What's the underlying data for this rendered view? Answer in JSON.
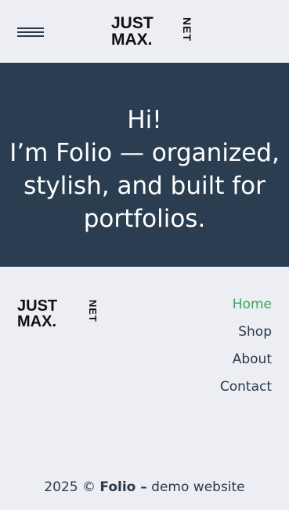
{
  "header": {
    "menu_icon": "hamburger-menu-icon",
    "logo": {
      "line1": "JUST",
      "line2": "MAX.",
      "vertical": "NET"
    }
  },
  "hero": {
    "greeting": "Hi!",
    "text": "I’m Folio — organized, stylish, and built for portfolios."
  },
  "footer": {
    "logo": {
      "line1": "JUST",
      "line2": "MAX.",
      "vertical": "NET"
    },
    "nav": [
      {
        "label": "Home",
        "active": true
      },
      {
        "label": "Shop"
      },
      {
        "label": "About"
      },
      {
        "label": "Contact"
      }
    ],
    "copyright": {
      "year_prefix": "2025 ©",
      "brand": "Folio –",
      "suffix": "demo website"
    }
  },
  "colors": {
    "background": "#eceef3",
    "hero_bg": "#2b3d51",
    "text": "#2b3a4b",
    "accent": "#3aa85c"
  }
}
